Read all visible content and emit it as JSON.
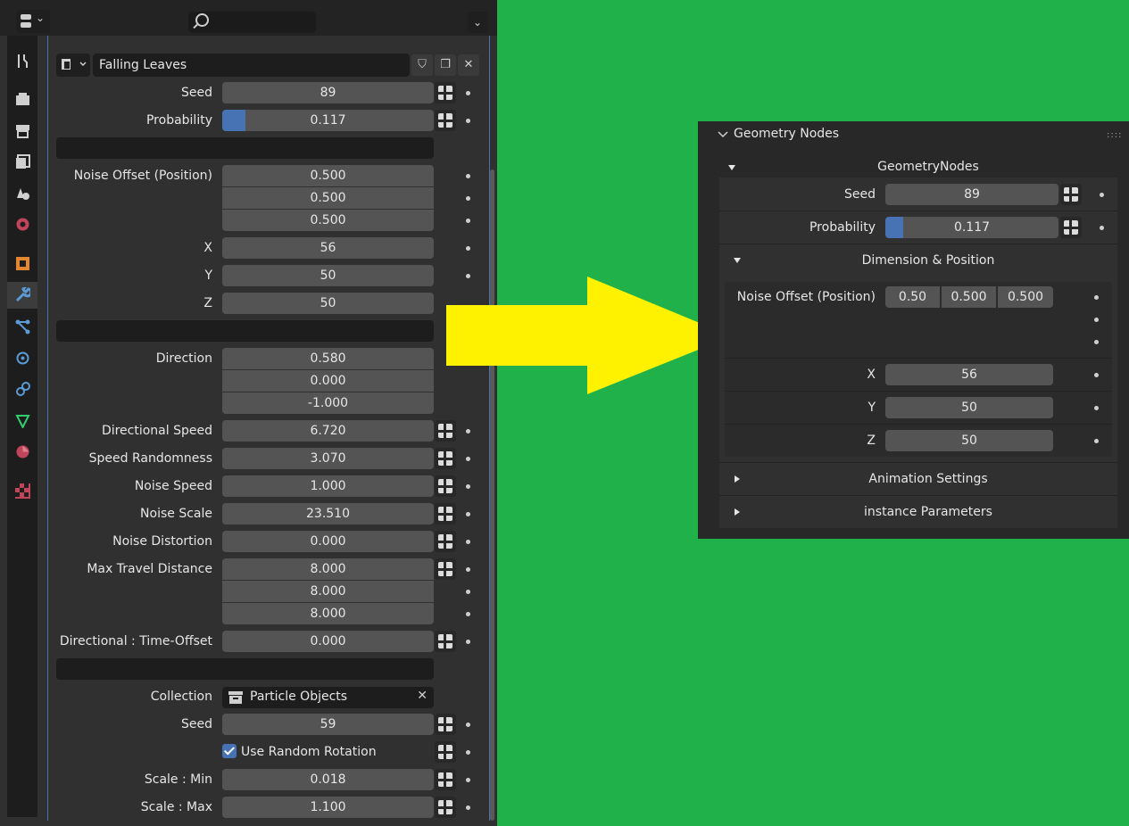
{
  "left_panel": {
    "modifier_name": "Falling Leaves",
    "rows": {
      "seed": {
        "label": "Seed",
        "value": "89"
      },
      "probability": {
        "label": "Probability",
        "value": "0.117",
        "fill": 0.117
      },
      "noise_offset": {
        "label": "Noise Offset (Position)",
        "values": [
          "0.500",
          "0.500",
          "0.500"
        ]
      },
      "x": {
        "label": "X",
        "value": "56"
      },
      "y": {
        "label": "Y",
        "value": "50"
      },
      "z": {
        "label": "Z",
        "value": "50"
      },
      "direction": {
        "label": "Direction",
        "values": [
          "0.580",
          "0.000",
          "-1.000"
        ]
      },
      "directional_speed": {
        "label": "Directional Speed",
        "value": "6.720"
      },
      "speed_randomness": {
        "label": "Speed Randomness",
        "value": "3.070"
      },
      "noise_speed": {
        "label": "Noise Speed",
        "value": "1.000"
      },
      "noise_scale": {
        "label": "Noise Scale",
        "value": "23.510"
      },
      "noise_distortion": {
        "label": "Noise Distortion",
        "value": "0.000"
      },
      "max_travel": {
        "label": "Max Travel Distance",
        "values": [
          "8.000",
          "8.000",
          "8.000"
        ]
      },
      "time_offset": {
        "label": "Directional : Time-Offset",
        "value": "0.000"
      },
      "collection": {
        "label": "Collection",
        "value": "Particle Objects"
      },
      "seed2": {
        "label": "Seed",
        "value": "59"
      },
      "random_rotation": {
        "label": "Use Random Rotation",
        "checked": true
      },
      "scale_min": {
        "label": "Scale : Min",
        "value": "0.018"
      },
      "scale_max": {
        "label": "Scale : Max",
        "value": "1.100"
      }
    }
  },
  "right_panel": {
    "title": "Geometry Nodes",
    "group": "GeometryNodes",
    "seed": {
      "label": "Seed",
      "value": "89"
    },
    "probability": {
      "label": "Probability",
      "value": "0.117",
      "fill": 0.117
    },
    "dimension_section": "Dimension & Position",
    "noise_offset": {
      "label": "Noise Offset (Position)",
      "values": [
        "0.50",
        "0.500",
        "0.500"
      ]
    },
    "x": {
      "label": "X",
      "value": "56"
    },
    "y": {
      "label": "Y",
      "value": "50"
    },
    "z": {
      "label": "Z",
      "value": "50"
    },
    "animation_section": "Animation Settings",
    "instance_section": "instance Parameters"
  },
  "colors": {
    "background": "#21b14b",
    "accent": "#4772b3",
    "arrow": "#fff200"
  }
}
